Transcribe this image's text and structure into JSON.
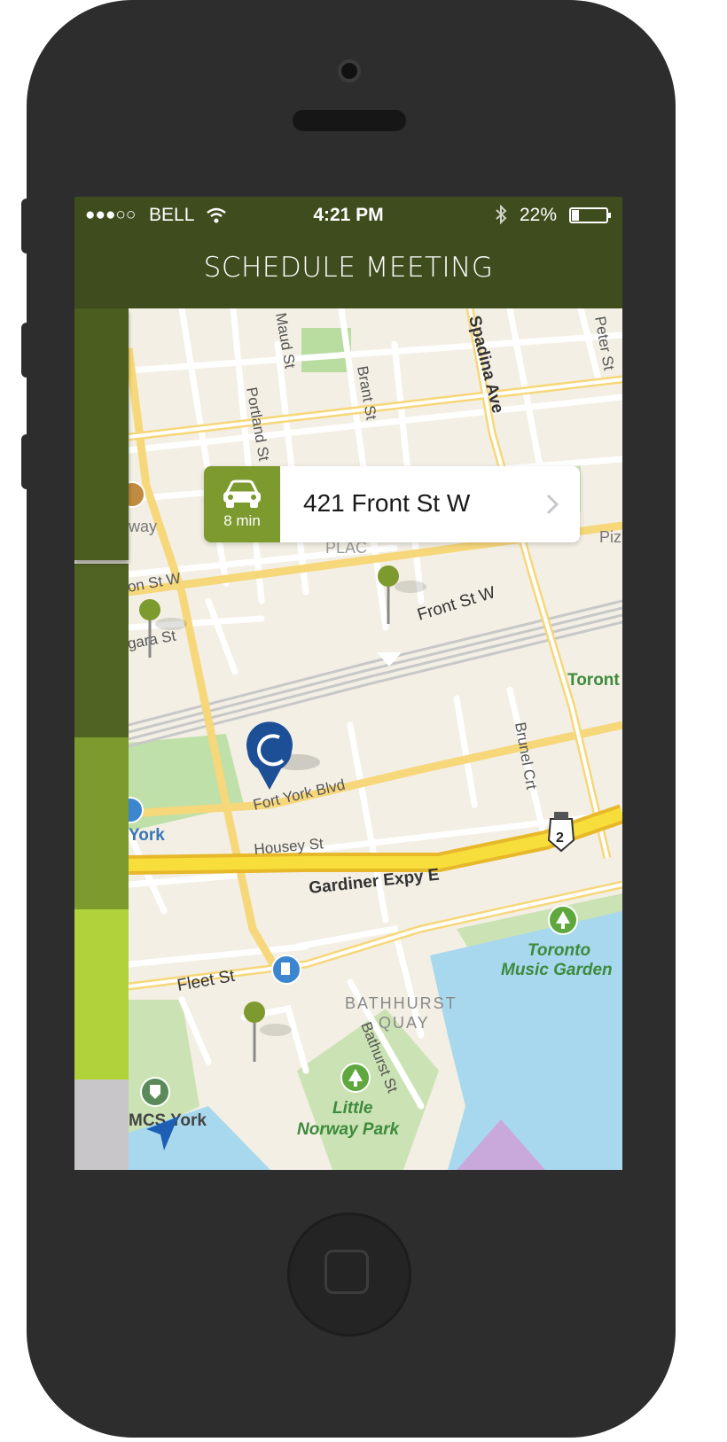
{
  "status_bar": {
    "signal": "●●●○○",
    "carrier": "BELL",
    "time": "4:21 PM",
    "battery_percent": "22%",
    "battery_level": 0.22,
    "icons": [
      "wifi-icon",
      "bluetooth-icon",
      "battery-icon"
    ]
  },
  "nav": {
    "title": "SCHEDULE MEETING"
  },
  "callout": {
    "travel_time": "8 min",
    "address": "421 Front St W",
    "icon": "car-icon",
    "accent": "#7c9a2e"
  },
  "map": {
    "streets": [
      "Maud St",
      "Brant St",
      "Portland St",
      "Spadina Ave",
      "Peter St",
      "Front St W",
      "Fort York Blvd",
      "Housey St",
      "Gardiner Expy E",
      "Brunel Crt",
      "Fleet St",
      "Bathurst St"
    ],
    "labels": {
      "quay_line1": "BATHHURST",
      "quay_line2": "QUAY",
      "park_line1": "Little",
      "park_line2": "Norway Park",
      "garden_line1": "Toronto",
      "garden_line2": "Music Garden",
      "toronto_edge": "Toront",
      "york": "York",
      "mcs_york": "MCS York",
      "placa": "PLAC",
      "piz": "Piz",
      "partial_front": "on St W",
      "partial_niagara": "gara St",
      "partial_way": "way",
      "highway_shield": "2"
    },
    "colors": {
      "land": "#f3efe4",
      "road": "#ffffff",
      "major_road": "#f6d77a",
      "expressway": "#f5cc2a",
      "water": "#a8d8ee",
      "park": "#cbe3b4",
      "pin_green": "#7c9a2e",
      "pin_blue": "#1c4f96"
    }
  },
  "sidebar": {
    "colors": [
      "#4a5e20",
      "#4f6422",
      "#7c9a2e",
      "#b0d23a",
      "#c9c6c9"
    ]
  }
}
